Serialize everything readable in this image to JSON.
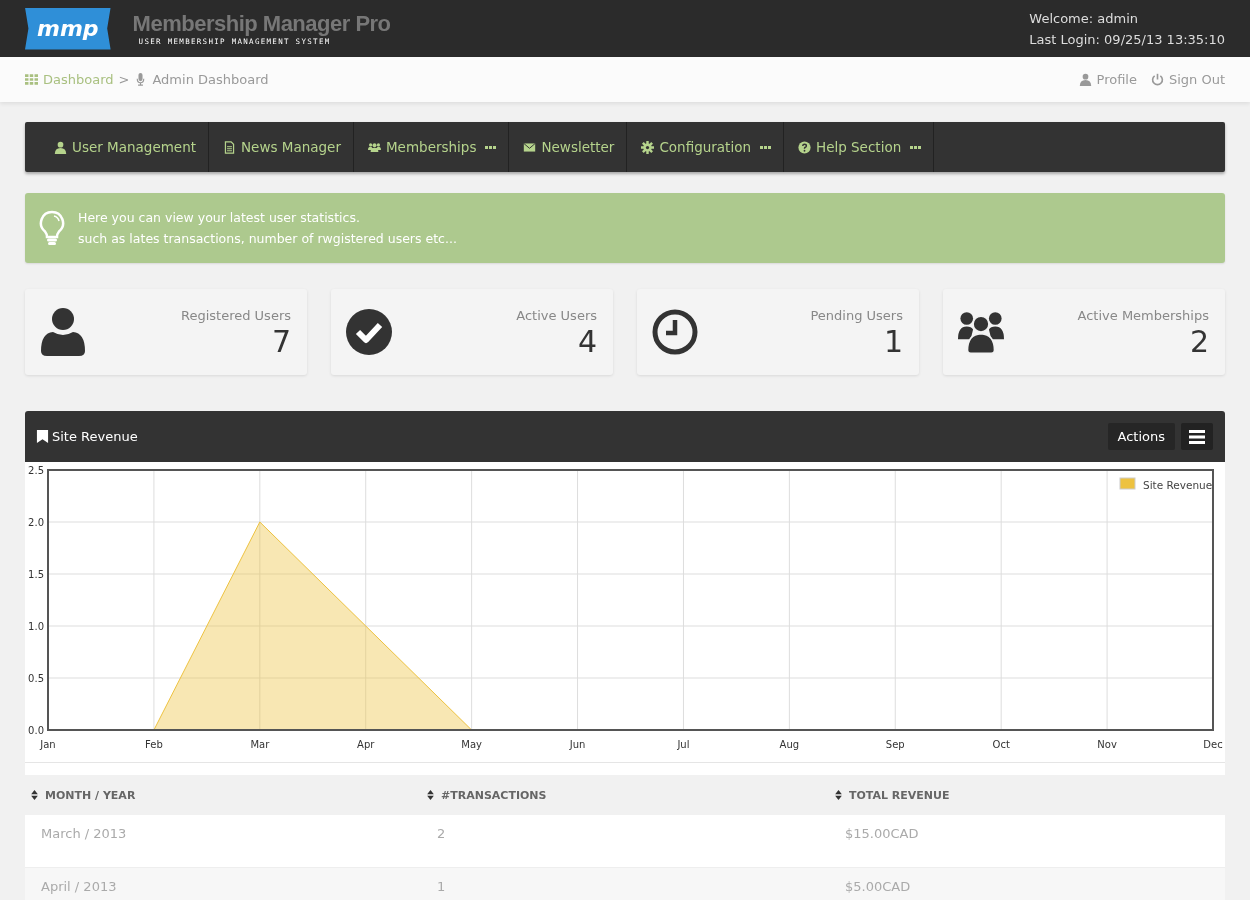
{
  "header": {
    "logo": "mmp",
    "title": "Membership Manager Pro",
    "subtitle": "USER MEMBERSHIP MANAGEMENT SYSTEM",
    "welcome": "Welcome: admin",
    "last_login": "Last Login: 09/25/13 13:35:10"
  },
  "breadcrumb": {
    "separator": ">",
    "items": [
      {
        "label": "Dashboard",
        "link": true
      },
      {
        "label": "Admin Dashboard",
        "link": false
      }
    ]
  },
  "user_links": [
    {
      "label": "Profile"
    },
    {
      "label": "Sign Out"
    }
  ],
  "nav": [
    {
      "label": "User Management",
      "dropdown": false
    },
    {
      "label": "News Manager",
      "dropdown": false
    },
    {
      "label": "Memberships",
      "dropdown": true
    },
    {
      "label": "Newsletter",
      "dropdown": false
    },
    {
      "label": "Configuration",
      "dropdown": true
    },
    {
      "label": "Help Section",
      "dropdown": true
    }
  ],
  "alert": {
    "lines": [
      "Here you can view your latest user statistics.",
      "such as lates transactions, number of rwgistered users etc..."
    ]
  },
  "stats": [
    {
      "label": "Registered Users",
      "value": "7"
    },
    {
      "label": "Active Users",
      "value": "4"
    },
    {
      "label": "Pending Users",
      "value": "1"
    },
    {
      "label": "Active Memberships",
      "value": "2"
    }
  ],
  "panel": {
    "title": "Site Revenue",
    "actions": "Actions",
    "chart_data": {
      "type": "area",
      "grid": true,
      "categories": [
        "Jan",
        "Feb",
        "Mar",
        "Apr",
        "May",
        "Jun",
        "Jul",
        "Aug",
        "Sep",
        "Oct",
        "Nov",
        "Dec"
      ],
      "ylim": [
        0,
        2.5
      ],
      "yticks": [
        {
          "value": 0,
          "label": "0.0"
        },
        {
          "value": 0.5,
          "label": "0.5"
        },
        {
          "value": 1,
          "label": "1.0"
        },
        {
          "value": 1.5,
          "label": "1.5"
        },
        {
          "value": 2,
          "label": "2.0"
        },
        {
          "value": 2.5,
          "label": "2.5"
        }
      ],
      "series": [
        {
          "name": "Site Revenue",
          "color": "#edc240",
          "values": [
            0,
            0,
            2,
            1,
            0,
            0,
            0,
            0,
            0,
            0,
            0,
            0
          ]
        }
      ]
    }
  },
  "table": {
    "columns": [
      "MONTH / YEAR",
      "#TRANSACTIONS",
      "TOTAL REVENUE"
    ],
    "rows": [
      [
        "March / 2013",
        "2",
        "$15.00CAD"
      ],
      [
        "April / 2013",
        "1",
        "$5.00CAD"
      ]
    ]
  }
}
